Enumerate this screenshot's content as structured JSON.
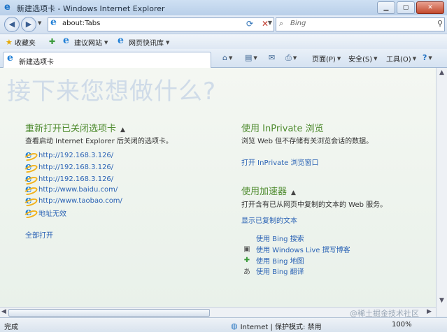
{
  "window": {
    "title": "新建选项卡 - Windows Internet Explorer"
  },
  "address": {
    "url": "about:Tabs",
    "search_placeholder": "Bing"
  },
  "favorites": {
    "favorites_label": "收藏夹",
    "suggested_sites": "建议网站",
    "web_slice_gallery": "网页快讯库"
  },
  "tab": {
    "label": "新建选项卡"
  },
  "commands": {
    "page": "页面(P)",
    "safety": "安全(S)",
    "tools": "工具(O)"
  },
  "content": {
    "heading": "接下来您想做什么?",
    "reopen": {
      "title": "重新打开已关闭选项卡",
      "desc": "查看启动 Internet Explorer 后关闭的选项卡。",
      "links": [
        "http://192.168.3.126/",
        "http://192.168.3.126/",
        "http://192.168.3.126/",
        "http://www.baidu.com/",
        "http://www.taobao.com/",
        "地址无效"
      ],
      "open_all": "全部打开"
    },
    "inprivate": {
      "title": "使用 InPrivate 浏览",
      "desc": "浏览 Web 但不存储有关浏览会话的数据。",
      "link": "打开 InPrivate 浏览窗口"
    },
    "accelerators": {
      "title": "使用加速器",
      "desc": "打开含有已从网页中复制的文本的 Web 服务。",
      "show_copied": "显示已复制的文本",
      "items": [
        "使用 Bing 搜索",
        "使用 Windows Live 撰写博客",
        "使用 Bing 地图",
        "使用 Bing 翻译"
      ]
    }
  },
  "status": {
    "text": "完成",
    "zone": "Internet | 保护模式: 禁用",
    "zoom": "100%"
  },
  "watermark": "@稀土掘金技术社区"
}
